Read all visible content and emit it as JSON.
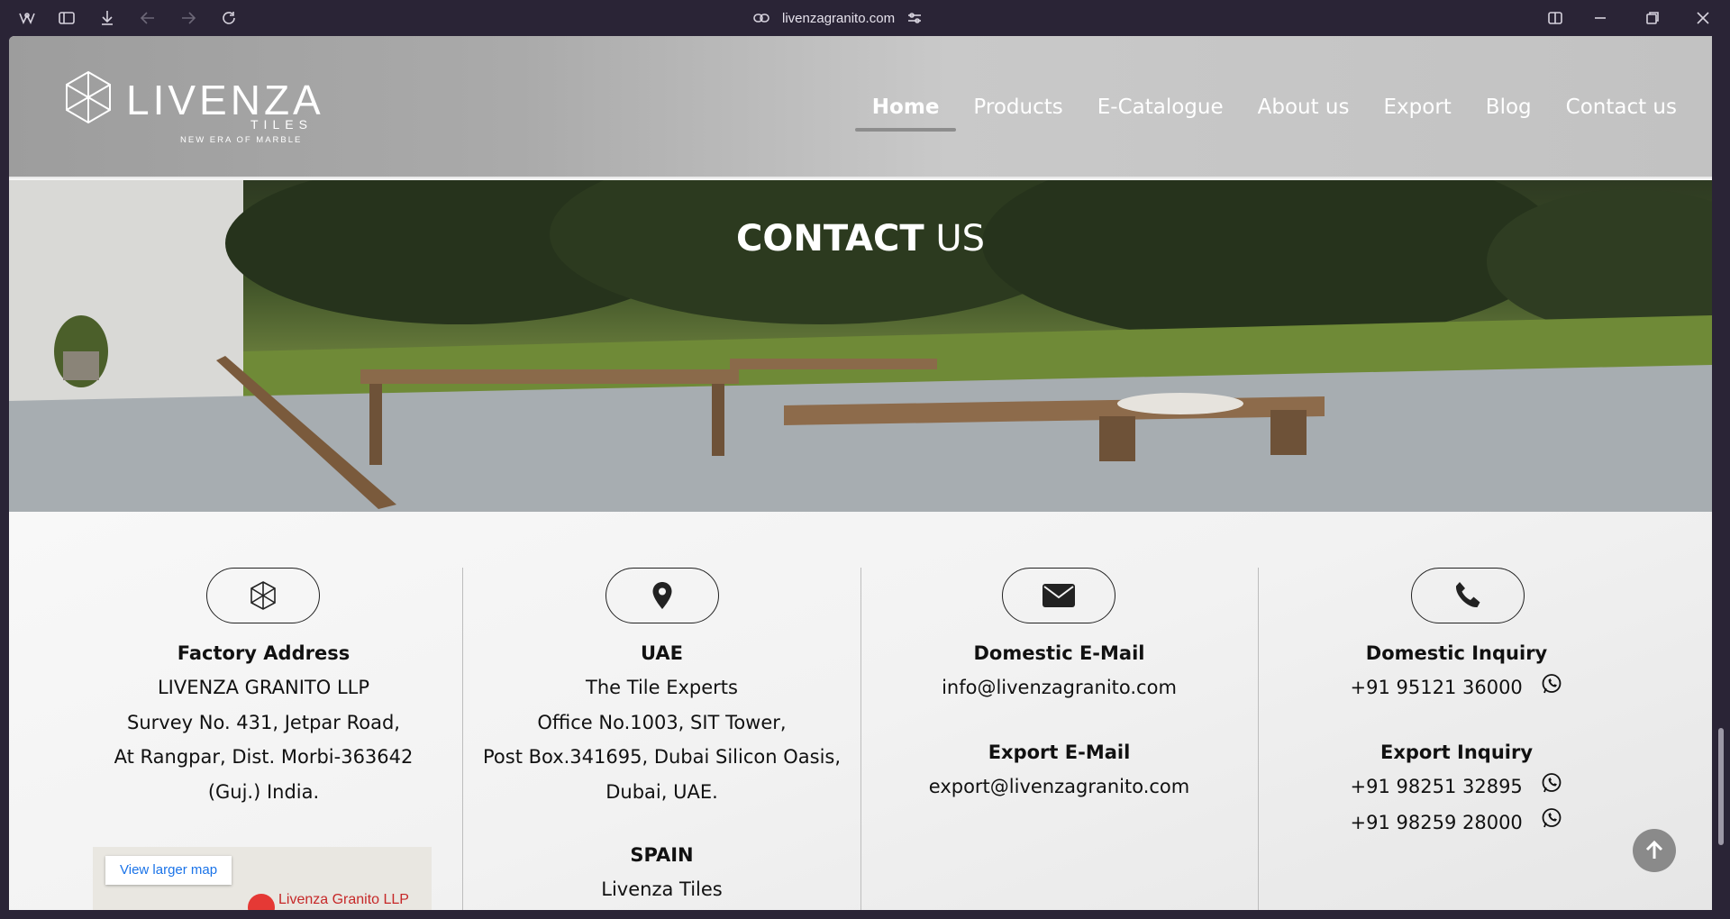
{
  "browser": {
    "url": "livenzagranito.com",
    "icons": [
      "brand-icon",
      "sidebar-toggle-icon",
      "download-icon",
      "back-icon",
      "forward-icon",
      "reload-icon",
      "link-icon",
      "site-settings-icon",
      "split-view-icon",
      "minimize-icon",
      "restore-icon",
      "close-icon"
    ]
  },
  "header": {
    "logo": {
      "wordmark": "LIVENZA",
      "sub": "TILES",
      "tagline": "NEW ERA OF MARBLE"
    },
    "nav": [
      {
        "label": "Home",
        "active": true
      },
      {
        "label": "Products"
      },
      {
        "label": "E-Catalogue"
      },
      {
        "label": "About us"
      },
      {
        "label": "Export"
      },
      {
        "label": "Blog"
      },
      {
        "label": "Contact us"
      }
    ]
  },
  "hero": {
    "title_bold": "CONTACT",
    "title_light": " US"
  },
  "contact": {
    "factory": {
      "title": "Factory Address",
      "lines": [
        "LIVENZA GRANITO LLP",
        "Survey No. 431, Jetpar Road,",
        "At Rangpar, Dist. Morbi-363642",
        "(Guj.) India."
      ]
    },
    "uae": {
      "title": "UAE",
      "lines": [
        "The Tile Experts",
        "Office No.1003, SIT Tower,",
        "Post Box.341695, Dubai Silicon Oasis,",
        "Dubai, UAE."
      ]
    },
    "spain": {
      "title": "SPAIN",
      "lines": [
        "Livenza Tiles"
      ]
    },
    "email": {
      "domestic_title": "Domestic E-Mail",
      "domestic": "info@livenzagranito.com",
      "export_title": "Export E-Mail",
      "export": "export@livenzagranito.com"
    },
    "phone": {
      "domestic_title": "Domestic Inquiry",
      "domestic": "+91 95121 36000",
      "export_title": "Export Inquiry",
      "export_1": "+91 98251 32895",
      "export_2": "+91 98259 28000"
    },
    "map": {
      "button": "View larger map",
      "place": "Livenza Granito LLP"
    }
  },
  "colors": {
    "accent_pin": "#e53935",
    "map_link": "#1a73e8",
    "chrome": "#2a2436"
  }
}
